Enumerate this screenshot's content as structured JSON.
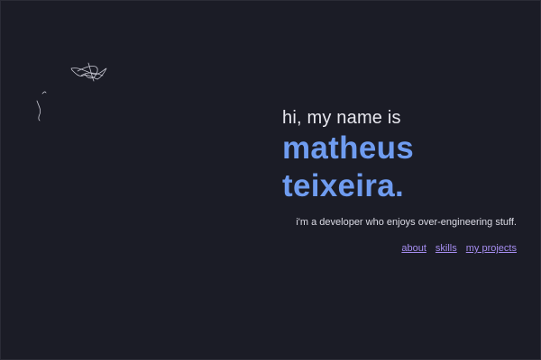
{
  "hero": {
    "greeting": "hi, my name is",
    "first_name": "matheus",
    "last_name": "teixeira."
  },
  "tagline": "i'm a developer who enjoys over-engineering stuff.",
  "nav": {
    "items": [
      {
        "label": "about"
      },
      {
        "label": "skills"
      },
      {
        "label": "my projects"
      }
    ]
  },
  "colors": {
    "background": "#1b1c26",
    "accent": "#6f9cf0",
    "link": "#a58df0",
    "text": "#e8e8ef"
  }
}
